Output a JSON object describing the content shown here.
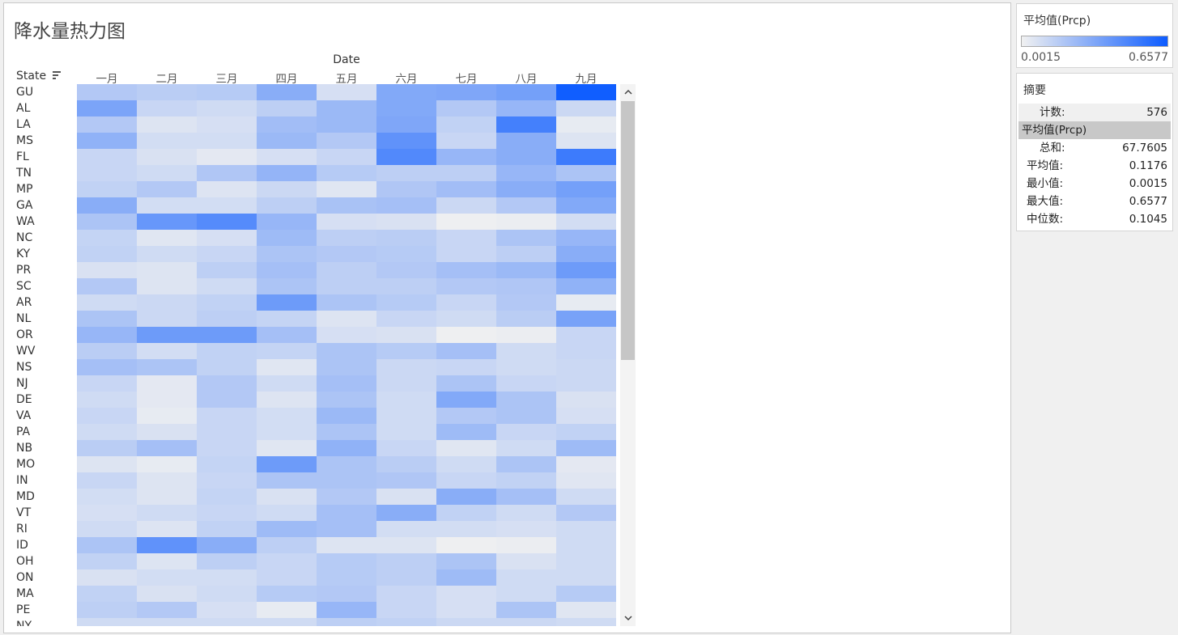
{
  "title": "降水量热力图",
  "x_axis_title": "Date",
  "row_header": "State",
  "legend": {
    "title": "平均值(Prcp)",
    "min_label": "0.0015",
    "max_label": "0.6577",
    "min_color": "#f1f1f1",
    "max_color": "#0d5cff"
  },
  "summary": {
    "title": "摘要",
    "count_label": "计数:",
    "count_value": "576",
    "measure_label": "平均值(Prcp)",
    "stats": [
      {
        "label": "总和:",
        "value": "67.7605"
      },
      {
        "label": "平均值:",
        "value": "0.1176"
      },
      {
        "label": "最小值:",
        "value": "0.0015"
      },
      {
        "label": "最大值:",
        "value": "0.6577"
      },
      {
        "label": "中位数:",
        "value": "0.1045"
      }
    ]
  },
  "chart_data": {
    "type": "heatmap",
    "measure": "平均值(Prcp)",
    "color_range": [
      0.0015,
      0.6577
    ],
    "columns": [
      "一月",
      "二月",
      "三月",
      "四月",
      "五月",
      "六月",
      "七月",
      "八月",
      "九月"
    ],
    "rows": [
      "GU",
      "AL",
      "LA",
      "MS",
      "FL",
      "TN",
      "MP",
      "GA",
      "WA",
      "NC",
      "KY",
      "PR",
      "SC",
      "AR",
      "NL",
      "OR",
      "WV",
      "NS",
      "NJ",
      "DE",
      "VA",
      "PA",
      "NB",
      "MO",
      "IN",
      "MD",
      "VT",
      "RI",
      "ID",
      "OH",
      "ON",
      "MA",
      "PE",
      "NY"
    ],
    "values": [
      [
        0.18,
        0.16,
        0.17,
        0.3,
        0.08,
        0.32,
        0.33,
        0.36,
        0.65
      ],
      [
        0.34,
        0.12,
        0.1,
        0.15,
        0.25,
        0.32,
        0.18,
        0.26,
        0.11
      ],
      [
        0.18,
        0.06,
        0.08,
        0.23,
        0.25,
        0.33,
        0.14,
        0.5,
        0.03
      ],
      [
        0.28,
        0.09,
        0.09,
        0.25,
        0.18,
        0.42,
        0.12,
        0.3,
        0.06
      ],
      [
        0.12,
        0.07,
        0.04,
        0.08,
        0.12,
        0.46,
        0.26,
        0.3,
        0.52
      ],
      [
        0.12,
        0.1,
        0.19,
        0.27,
        0.17,
        0.15,
        0.15,
        0.26,
        0.2
      ],
      [
        0.14,
        0.18,
        0.06,
        0.11,
        0.05,
        0.19,
        0.23,
        0.3,
        0.36
      ],
      [
        0.3,
        0.09,
        0.09,
        0.15,
        0.21,
        0.22,
        0.11,
        0.18,
        0.32
      ],
      [
        0.2,
        0.4,
        0.45,
        0.26,
        0.08,
        0.07,
        0.01,
        0.02,
        0.09
      ],
      [
        0.13,
        0.05,
        0.08,
        0.24,
        0.15,
        0.16,
        0.12,
        0.2,
        0.26
      ],
      [
        0.14,
        0.1,
        0.12,
        0.2,
        0.18,
        0.17,
        0.12,
        0.15,
        0.3
      ],
      [
        0.07,
        0.06,
        0.15,
        0.22,
        0.15,
        0.18,
        0.22,
        0.25,
        0.38
      ],
      [
        0.18,
        0.06,
        0.1,
        0.2,
        0.15,
        0.15,
        0.18,
        0.19,
        0.28
      ],
      [
        0.1,
        0.11,
        0.14,
        0.38,
        0.2,
        0.17,
        0.12,
        0.18,
        0.03
      ],
      [
        0.2,
        0.11,
        0.15,
        0.13,
        0.06,
        0.12,
        0.1,
        0.16,
        0.35
      ],
      [
        0.26,
        0.38,
        0.38,
        0.22,
        0.08,
        0.07,
        0.01,
        0.02,
        0.12
      ],
      [
        0.16,
        0.09,
        0.14,
        0.13,
        0.2,
        0.17,
        0.22,
        0.1,
        0.12
      ],
      [
        0.22,
        0.2,
        0.14,
        0.05,
        0.2,
        0.11,
        0.12,
        0.1,
        0.11
      ],
      [
        0.12,
        0.04,
        0.18,
        0.1,
        0.22,
        0.11,
        0.2,
        0.12,
        0.11
      ],
      [
        0.1,
        0.04,
        0.18,
        0.06,
        0.2,
        0.1,
        0.32,
        0.2,
        0.07
      ],
      [
        0.12,
        0.03,
        0.12,
        0.09,
        0.25,
        0.1,
        0.18,
        0.2,
        0.08
      ],
      [
        0.1,
        0.07,
        0.12,
        0.09,
        0.2,
        0.1,
        0.24,
        0.12,
        0.14
      ],
      [
        0.16,
        0.22,
        0.12,
        0.05,
        0.28,
        0.12,
        0.05,
        0.1,
        0.24
      ],
      [
        0.06,
        0.03,
        0.13,
        0.38,
        0.2,
        0.16,
        0.1,
        0.2,
        0.04
      ],
      [
        0.12,
        0.06,
        0.12,
        0.2,
        0.2,
        0.19,
        0.12,
        0.14,
        0.05
      ],
      [
        0.09,
        0.06,
        0.13,
        0.07,
        0.18,
        0.07,
        0.3,
        0.22,
        0.1
      ],
      [
        0.08,
        0.1,
        0.12,
        0.1,
        0.22,
        0.3,
        0.14,
        0.1,
        0.18
      ],
      [
        0.1,
        0.06,
        0.14,
        0.24,
        0.22,
        0.09,
        0.09,
        0.08,
        0.1
      ],
      [
        0.2,
        0.42,
        0.3,
        0.15,
        0.06,
        0.06,
        0.01,
        0.02,
        0.1
      ],
      [
        0.14,
        0.06,
        0.15,
        0.12,
        0.17,
        0.15,
        0.2,
        0.07,
        0.1
      ],
      [
        0.07,
        0.09,
        0.09,
        0.12,
        0.17,
        0.15,
        0.24,
        0.1,
        0.1
      ],
      [
        0.14,
        0.07,
        0.1,
        0.17,
        0.18,
        0.12,
        0.08,
        0.1,
        0.17
      ],
      [
        0.15,
        0.18,
        0.08,
        0.03,
        0.26,
        0.12,
        0.08,
        0.2,
        0.05
      ],
      [
        0.1,
        0.1,
        0.1,
        0.1,
        0.15,
        0.14,
        0.11,
        0.11,
        0.1
      ]
    ],
    "legend_position": "top-right",
    "grid": false
  }
}
